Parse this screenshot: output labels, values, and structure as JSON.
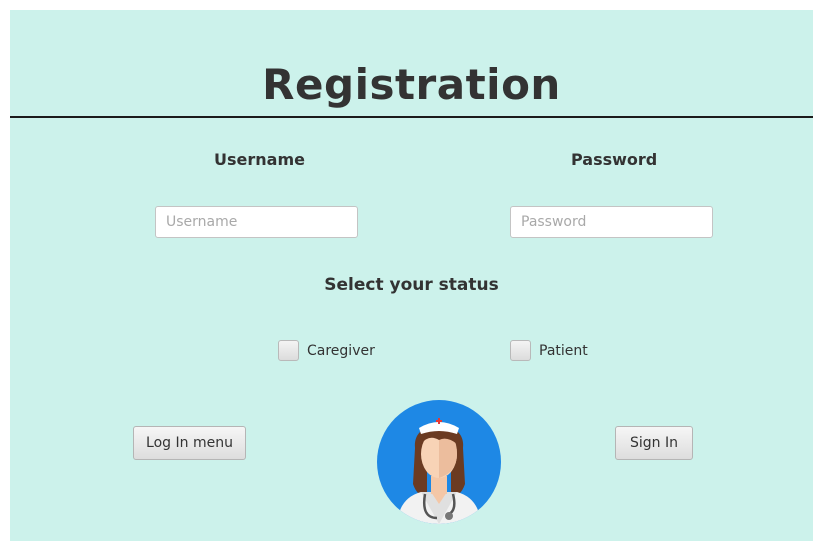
{
  "header": {
    "title": "Registration"
  },
  "form": {
    "username_label": "Username",
    "username_placeholder": "Username",
    "username_value": "",
    "password_label": "Password",
    "password_placeholder": "Password",
    "password_value": ""
  },
  "status": {
    "title": "Select your status",
    "options": [
      {
        "label": "Caregiver",
        "checked": false
      },
      {
        "label": "Patient",
        "checked": false
      }
    ]
  },
  "buttons": {
    "login_menu": "Log In menu",
    "sign_in": "Sign In"
  },
  "avatar": {
    "icon": "nurse-avatar-icon"
  },
  "colors": {
    "background": "#ccf2eb",
    "text": "#333333",
    "avatar_circle": "#1e88e5"
  }
}
